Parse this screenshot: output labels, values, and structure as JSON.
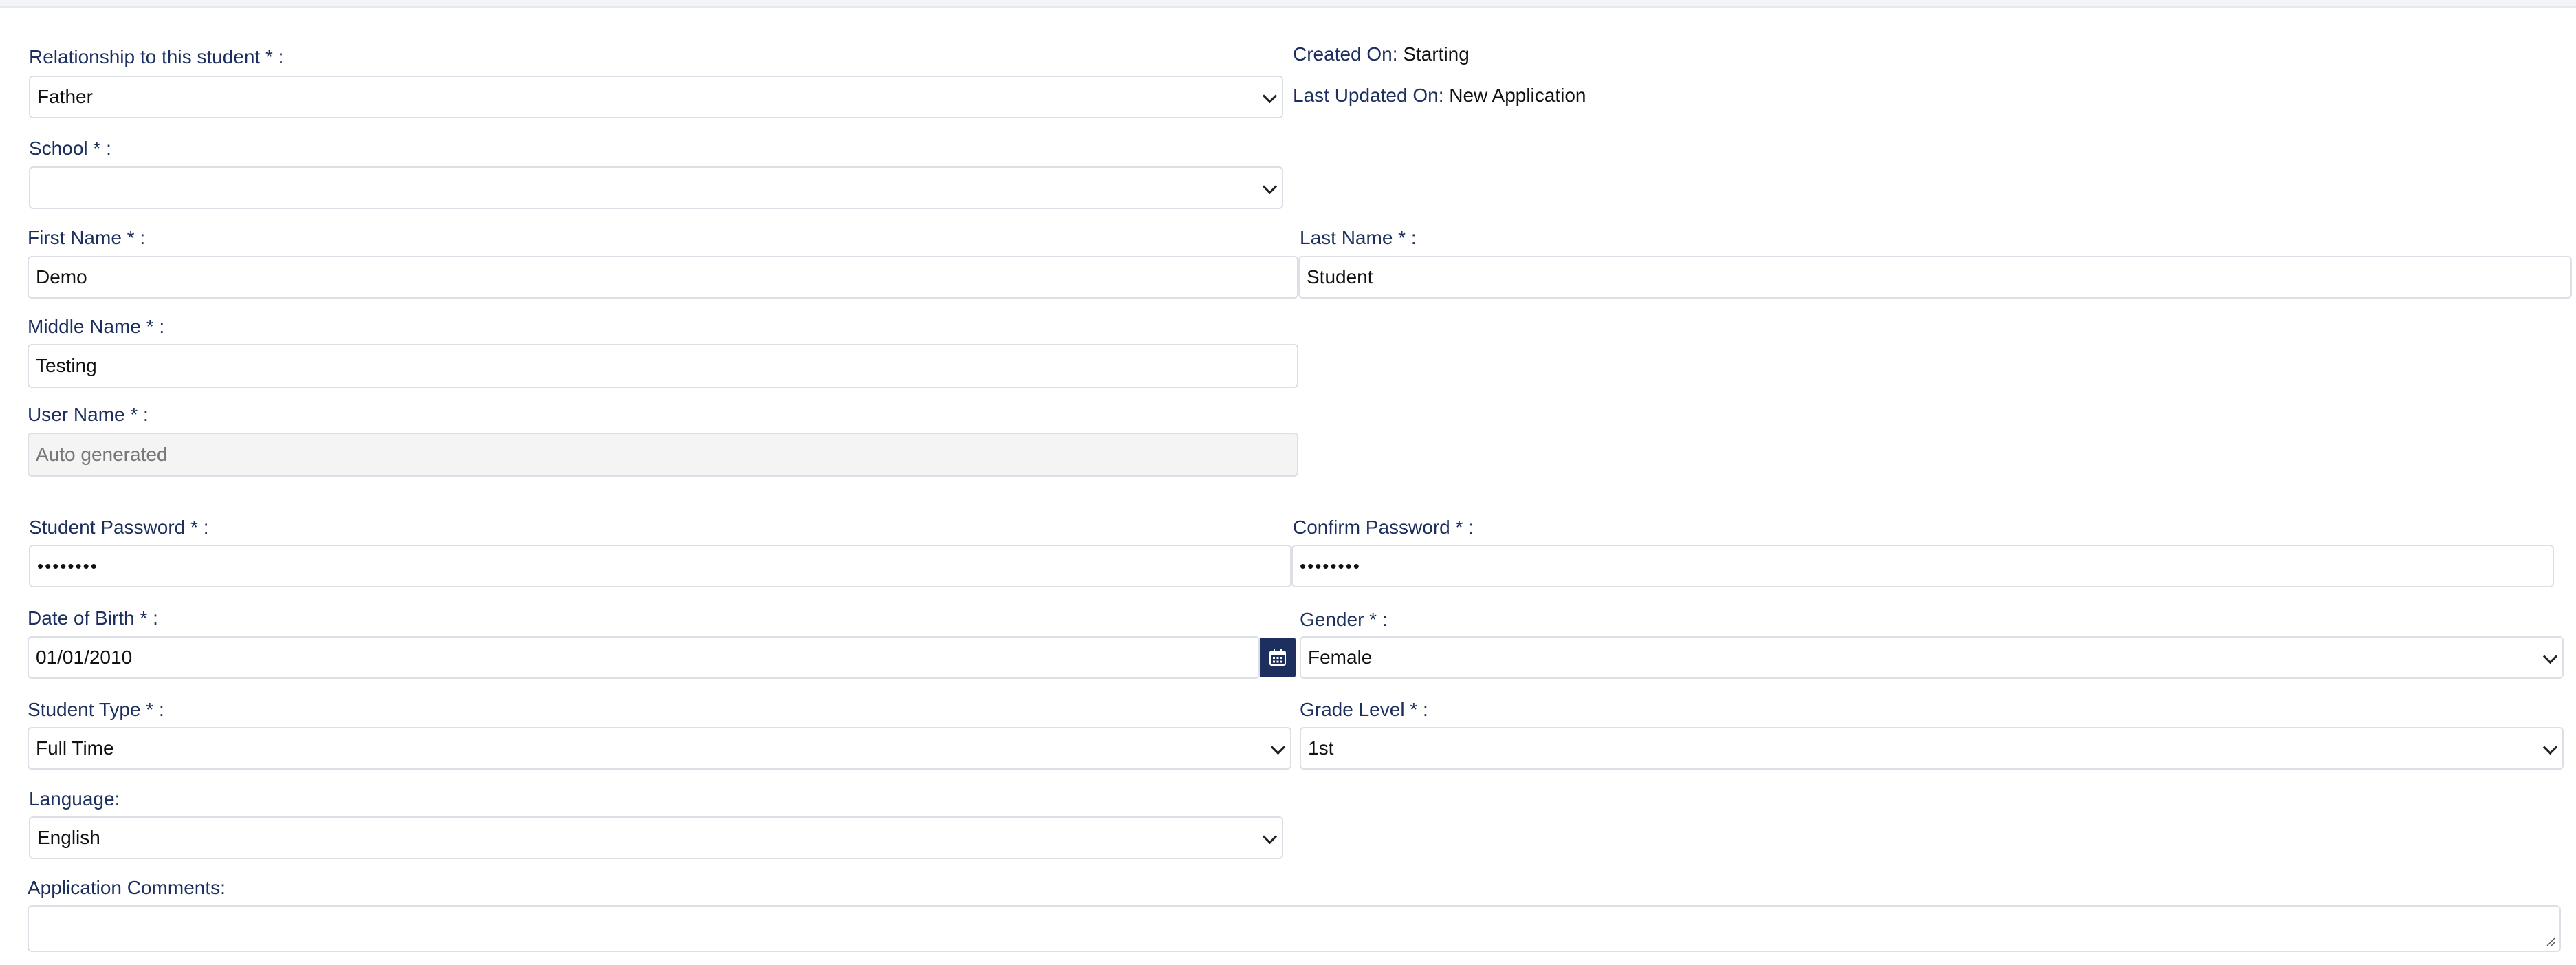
{
  "meta": {
    "created_on_label": "Created On:",
    "created_on_value": "Starting",
    "last_updated_label": "Last Updated On:",
    "last_updated_value": "New Application"
  },
  "form": {
    "relationship": {
      "label": "Relationship to this student * :",
      "value": "Father"
    },
    "school": {
      "label": "School * :",
      "value": ""
    },
    "first_name": {
      "label": "First Name * :",
      "value": "Demo"
    },
    "last_name": {
      "label": "Last Name * :",
      "value": "Student"
    },
    "middle_name": {
      "label": "Middle Name * :",
      "value": "Testing"
    },
    "user_name": {
      "label": "User Name * :",
      "placeholder": "Auto generated"
    },
    "student_password": {
      "label": "Student Password * :",
      "value": "••••••••"
    },
    "confirm_password": {
      "label": "Confirm Password * :",
      "value": "••••••••"
    },
    "date_of_birth": {
      "label": "Date of Birth * :",
      "value": "01/01/2010"
    },
    "gender": {
      "label": "Gender * :",
      "value": "Female"
    },
    "student_type": {
      "label": "Student Type * :",
      "value": "Full Time"
    },
    "grade_level": {
      "label": "Grade Level * :",
      "value": "1st"
    },
    "language": {
      "label": "Language:",
      "value": "English"
    },
    "application_comments": {
      "label": "Application Comments:",
      "value": ""
    }
  },
  "icons": {
    "calendar": "calendar-icon",
    "chevron": "chevron-down-icon",
    "resize": "resize-grip-icon"
  },
  "colors": {
    "label": "#1c2f5e",
    "accent": "#1c2f5e",
    "border": "#dcdfe6",
    "disabled_bg": "#f4f4f4"
  }
}
